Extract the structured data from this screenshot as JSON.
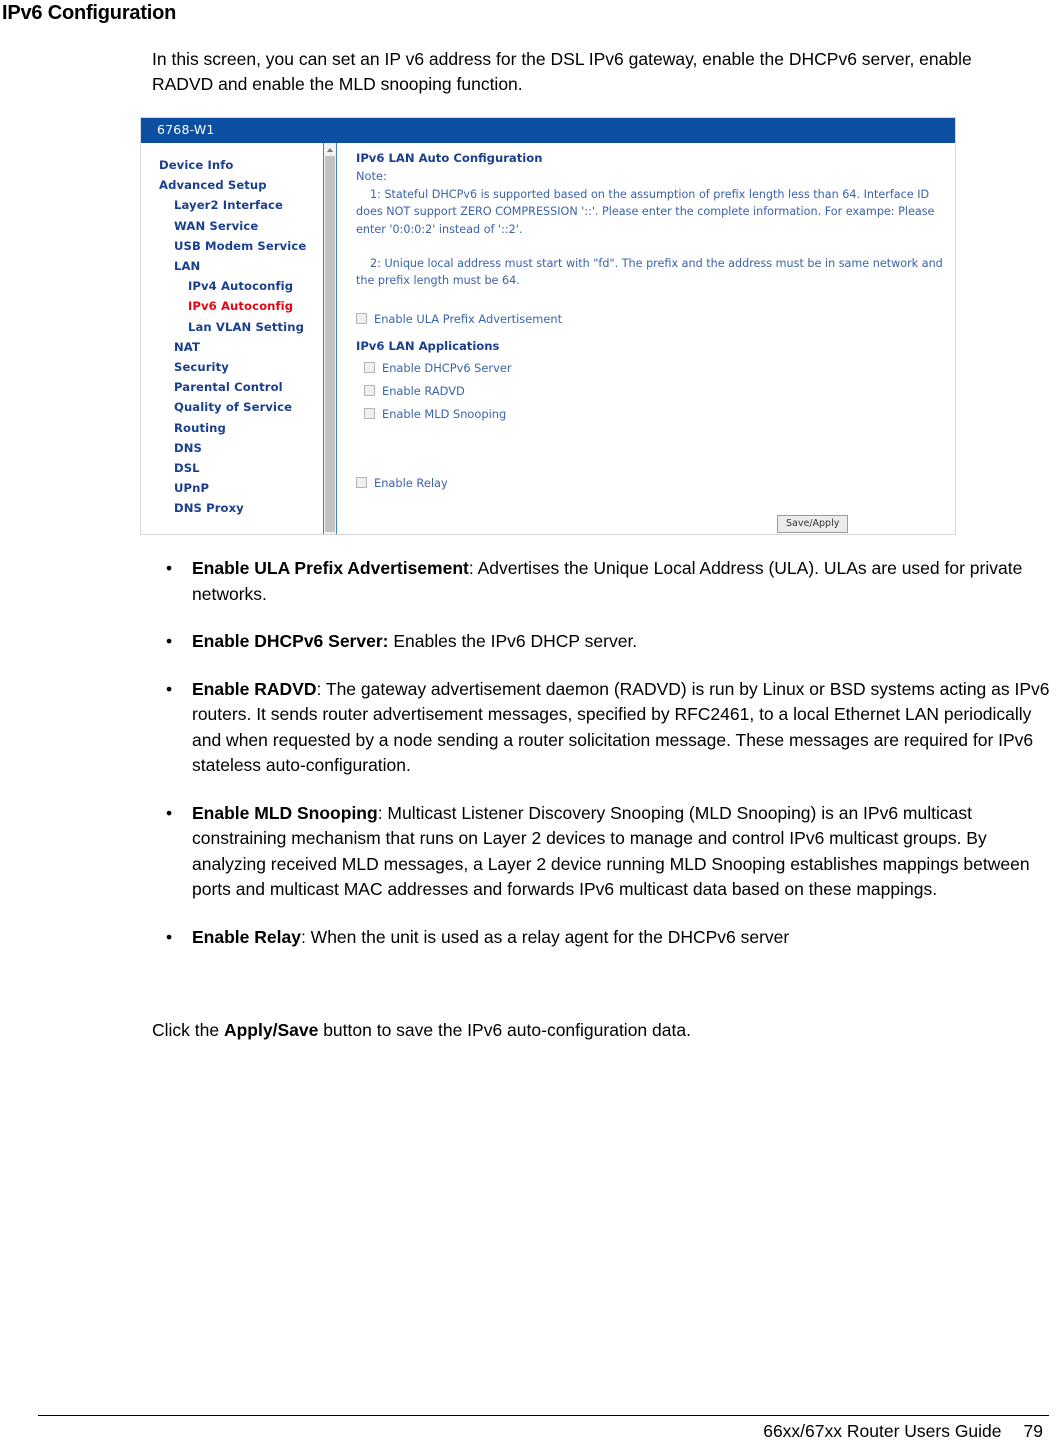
{
  "document": {
    "heading": "IPv6 Configuration",
    "intro": "In this screen, you can set an IP v6 address for the DSL IPv6 gateway, enable the DHCPv6 server, enable RADVD and enable the MLD snooping function.",
    "closing_prefix": "Click the ",
    "closing_bold": "Apply/Save",
    "closing_suffix": " button to save the IPv6 auto-configuration data."
  },
  "footer": {
    "guide": "66xx/67xx Router Users Guide",
    "page_number": "79"
  },
  "router_ui": {
    "titlebar": "6768-W1",
    "sidebar": [
      {
        "label": "Device Info",
        "level": 0,
        "active": false
      },
      {
        "label": "Advanced Setup",
        "level": 0,
        "active": false
      },
      {
        "label": "Layer2 Interface",
        "level": 1,
        "active": false
      },
      {
        "label": "WAN Service",
        "level": 1,
        "active": false
      },
      {
        "label": "USB Modem Service",
        "level": 1,
        "active": false
      },
      {
        "label": "LAN",
        "level": 1,
        "active": false
      },
      {
        "label": "IPv4 Autoconfig",
        "level": 2,
        "active": false
      },
      {
        "label": "IPv6 Autoconfig",
        "level": 2,
        "active": true
      },
      {
        "label": "Lan VLAN Setting",
        "level": 2,
        "active": false
      },
      {
        "label": "NAT",
        "level": 1,
        "active": false
      },
      {
        "label": "Security",
        "level": 1,
        "active": false
      },
      {
        "label": "Parental Control",
        "level": 1,
        "active": false
      },
      {
        "label": "Quality of Service",
        "level": 1,
        "active": false
      },
      {
        "label": "Routing",
        "level": 1,
        "active": false
      },
      {
        "label": "DNS",
        "level": 1,
        "active": false
      },
      {
        "label": "DSL",
        "level": 1,
        "active": false
      },
      {
        "label": "UPnP",
        "level": 1,
        "active": false
      },
      {
        "label": "DNS Proxy",
        "level": 1,
        "active": false
      }
    ],
    "content": {
      "section_auto_config": "IPv6 LAN Auto Configuration",
      "note_label": "Note:",
      "note_1": "1: Stateful DHCPv6 is supported based on the assumption of prefix length less than 64. Interface ID does NOT support ZERO COMPRESSION '::'. Please enter the complete information. For exampe: Please enter '0:0:0:2' instead of '::2'.",
      "note_2": "2: Unique local address must start with \"fd\". The prefix and the address must be in same network and the prefix length must be 64.",
      "checkbox_ula": "Enable ULA Prefix Advertisement",
      "section_applications": "IPv6 LAN Applications",
      "checkbox_dhcpv6": "Enable DHCPv6 Server",
      "checkbox_radvd": "Enable RADVD",
      "checkbox_mld": "Enable MLD Snooping",
      "checkbox_relay": "Enable Relay",
      "save_button": "Save/Apply"
    },
    "colors": {
      "titlebar_bg": "#0b4ea2",
      "menu_text": "#1b3f8f",
      "menu_active": "#e30613",
      "content_text": "#3a63ad"
    }
  },
  "bullets": [
    {
      "term": "Enable ULA Prefix Advertisement",
      "body": ": Advertises the Unique Local Address (ULA). ULAs are used for private networks."
    },
    {
      "term": "Enable DHCPv6 Server:",
      "body": " Enables the IPv6 DHCP server."
    },
    {
      "term": "Enable RADVD",
      "body": ": The gateway advertisement daemon (RADVD) is run by Linux or BSD systems acting as IPv6 routers. It sends router advertisement messages, specified by RFC2461, to a local Ethernet LAN periodically and when requested by a node sending a router solicitation message. These messages are required for IPv6 stateless auto-configuration."
    },
    {
      "term": "Enable MLD Snooping",
      "body": ": Multicast Listener Discovery Snooping (MLD Snooping) is an IPv6 multicast constraining mechanism that runs on Layer 2 devices to manage and control IPv6 multicast groups. By analyzing received MLD messages, a Layer 2 device running MLD Snooping establishes mappings between ports and multicast MAC addresses and forwards IPv6 multicast data based on these mappings."
    },
    {
      "term": "Enable Relay",
      "body": ": When the unit is used as a relay agent for the DHCPv6 server"
    }
  ],
  "icons": {
    "bullet_glyph": "•",
    "scroll_up": "scroll-up-arrow-icon"
  }
}
